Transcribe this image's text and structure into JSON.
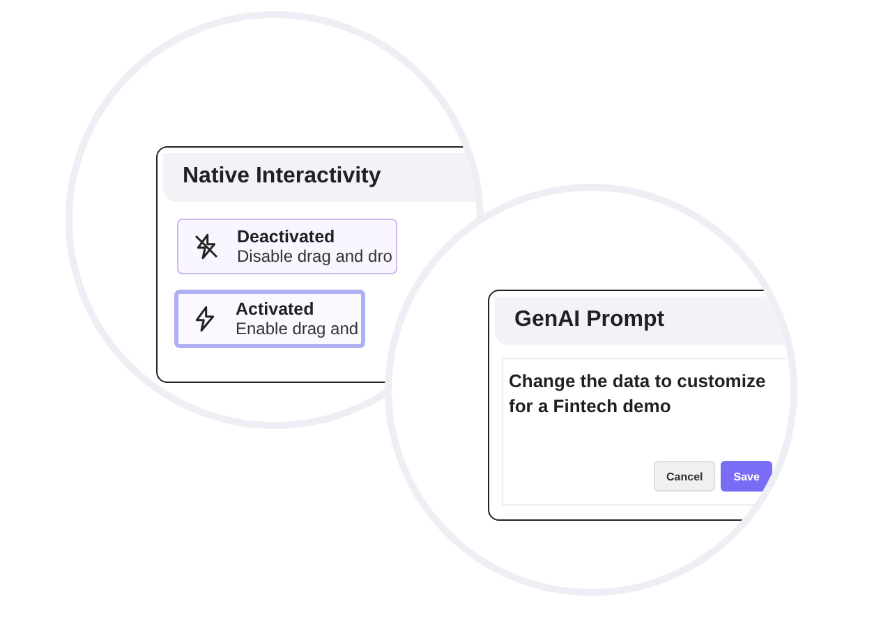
{
  "interactivity_panel": {
    "title": "Native Interactivity",
    "options": [
      {
        "kind": "off",
        "label": "Deactivated",
        "description": "Disable drag and dro",
        "selected": false
      },
      {
        "kind": "on",
        "label": "Activated",
        "description": "Enable drag and",
        "selected": true
      }
    ]
  },
  "prompt_panel": {
    "title": "GenAI Prompt",
    "text": "Change the data to customize for a Fintech demo",
    "buttons": [
      {
        "kind": "secondary",
        "label": "Cancel"
      },
      {
        "kind": "primary",
        "label": "Save"
      }
    ]
  }
}
